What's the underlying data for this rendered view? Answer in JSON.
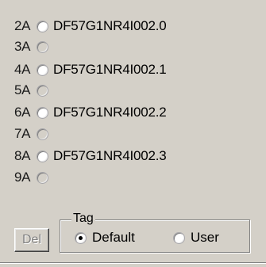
{
  "slots": [
    {
      "label": "2A",
      "value": "DF57G1NR4I002.0",
      "enabled": true
    },
    {
      "label": "3A",
      "value": "",
      "enabled": false
    },
    {
      "label": "4A",
      "value": "DF57G1NR4I002.1",
      "enabled": true
    },
    {
      "label": "5A",
      "value": "",
      "enabled": false
    },
    {
      "label": "6A",
      "value": "DF57G1NR4I002.2",
      "enabled": true
    },
    {
      "label": "7A",
      "value": "",
      "enabled": false
    },
    {
      "label": "8A",
      "value": "DF57G1NR4I002.3",
      "enabled": true
    },
    {
      "label": "9A",
      "value": "",
      "enabled": false
    }
  ],
  "del_button": {
    "label": "Del",
    "enabled": false
  },
  "tag": {
    "legend": "Tag",
    "options": [
      {
        "label": "Default",
        "selected": true
      },
      {
        "label": "User",
        "selected": false
      }
    ]
  }
}
